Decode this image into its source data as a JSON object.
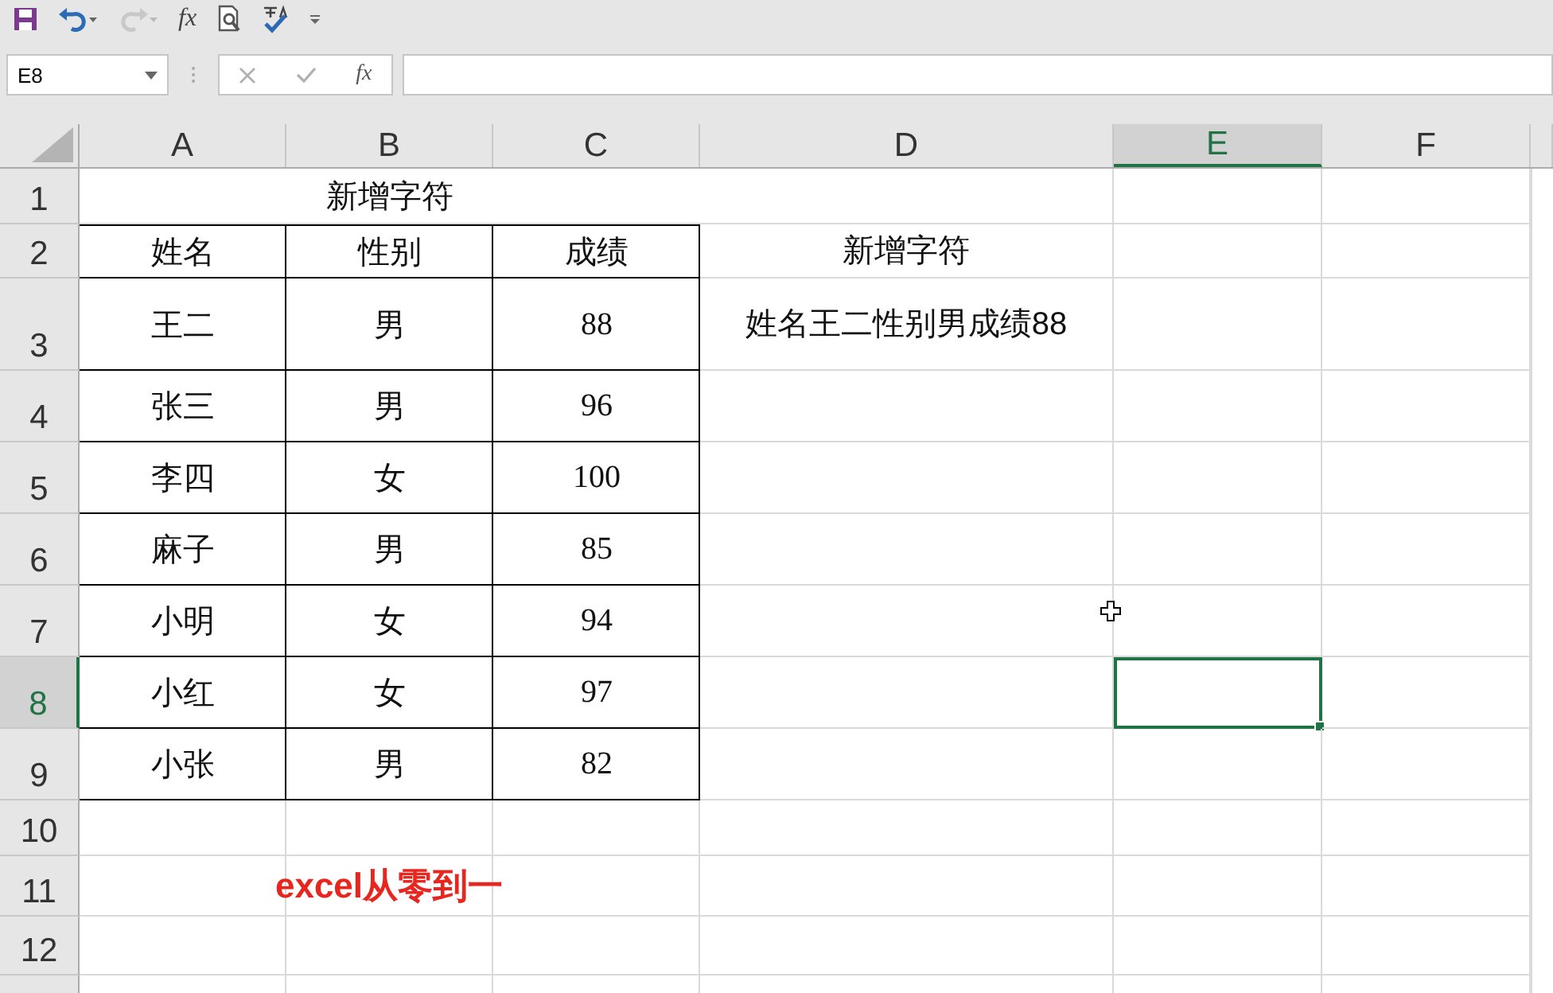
{
  "quick_access": {
    "formula_label": "fx",
    "redo_disabled": true
  },
  "formula_bar": {
    "name_box": "E8",
    "function_label": "fx"
  },
  "columns": [
    {
      "label": "A",
      "selected": false
    },
    {
      "label": "B",
      "selected": false
    },
    {
      "label": "C",
      "selected": false
    },
    {
      "label": "D",
      "selected": false
    },
    {
      "label": "E",
      "selected": true
    },
    {
      "label": "F",
      "selected": false
    }
  ],
  "rows": [
    {
      "number": "1",
      "selected": false,
      "title": "新增字符"
    },
    {
      "number": "2",
      "selected": false,
      "bordered": true,
      "cells": [
        "姓名",
        "性别",
        "成绩",
        "新增字符"
      ]
    },
    {
      "number": "3",
      "selected": false,
      "bordered": true,
      "cells": [
        "王二",
        "男",
        "88",
        "姓名王二性别男成绩88"
      ]
    },
    {
      "number": "4",
      "selected": false,
      "bordered": true,
      "cells": [
        "张三",
        "男",
        "96"
      ]
    },
    {
      "number": "5",
      "selected": false,
      "bordered": true,
      "cells": [
        "李四",
        "女",
        "100"
      ]
    },
    {
      "number": "6",
      "selected": false,
      "bordered": true,
      "cells": [
        "麻子",
        "男",
        "85"
      ]
    },
    {
      "number": "7",
      "selected": false,
      "bordered": true,
      "cells": [
        "小明",
        "女",
        "94"
      ]
    },
    {
      "number": "8",
      "selected": true,
      "bordered": true,
      "cells": [
        "小红",
        "女",
        "97"
      ]
    },
    {
      "number": "9",
      "selected": false,
      "bordered": true,
      "cells": [
        "小张",
        "男",
        "82"
      ]
    },
    {
      "number": "10",
      "selected": false
    },
    {
      "number": "11",
      "selected": false,
      "note": "excel从零到一"
    },
    {
      "number": "12",
      "selected": false
    }
  ]
}
